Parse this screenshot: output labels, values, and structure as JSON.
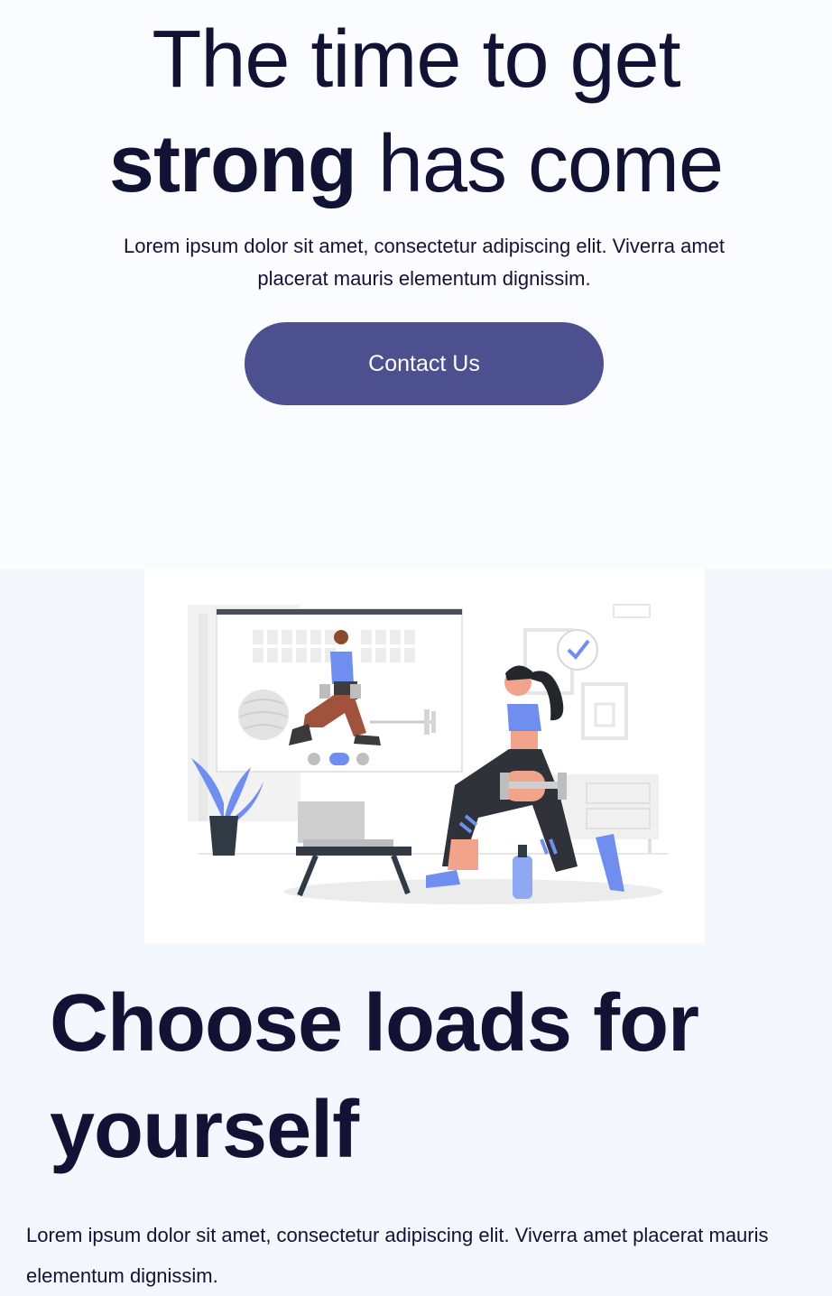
{
  "hero": {
    "title_line1": "The time to get",
    "title_bold": "strong",
    "title_line2_rest": " has come",
    "description": "Lorem ipsum dolor sit amet, consectetur adipiscing elit. Viverra amet placerat mauris elementum dignissim.",
    "cta_label": "Contact Us"
  },
  "section": {
    "title_regular": "Choose loads ",
    "title_bold_1": "for",
    "title_bold_2": "yourself",
    "description": "Lorem ipsum dolor sit amet, consectetur adipiscing elit. Viverra amet placerat mauris elementum dignissim."
  },
  "colors": {
    "text": "#121334",
    "button": "#4c508f",
    "accent_blue": "#6f8ef0"
  },
  "illustration": {
    "name": "online-workout-illustration"
  }
}
